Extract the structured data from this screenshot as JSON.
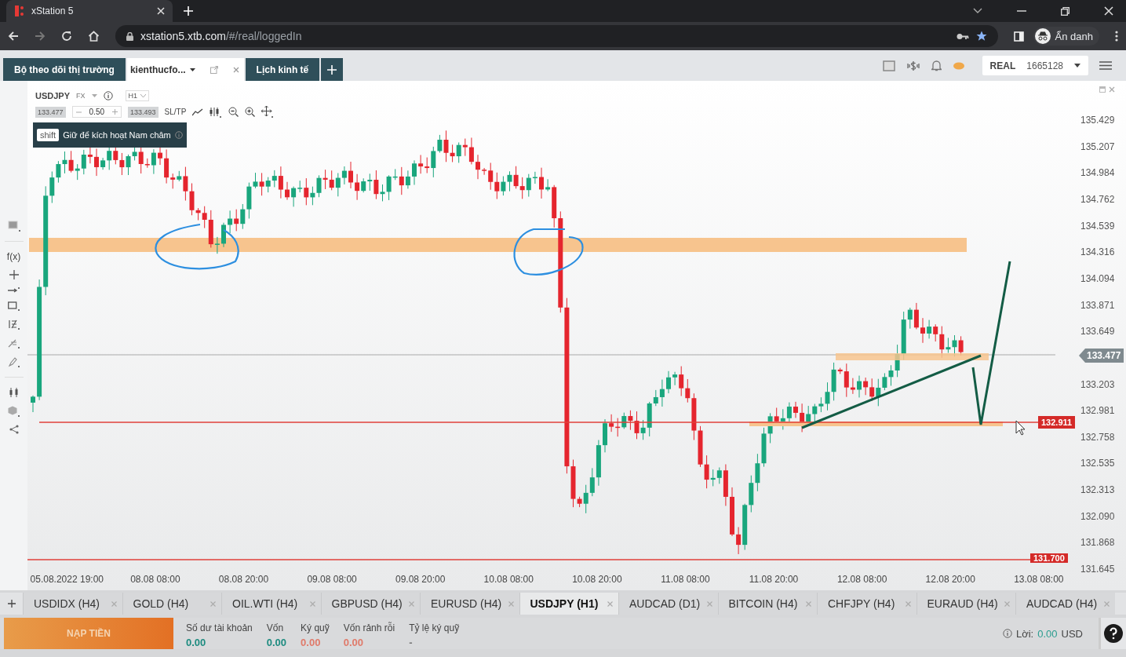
{
  "browser": {
    "tab_title": "xStation 5",
    "url_host": "xstation5.xtb.com",
    "url_path": "/#/real/loggedIn",
    "profile": "Ẩn danh"
  },
  "app_tabs": [
    {
      "label": "Bộ theo dõi thị trường",
      "selected": false
    },
    {
      "label": "kienthucfo...",
      "selected": true
    },
    {
      "label": "Lịch kinh tế",
      "selected": false
    }
  ],
  "account": {
    "mode": "REAL",
    "number": "1665128"
  },
  "chart": {
    "symbol": "USDJPY",
    "market": "FX",
    "timeframe": "H1",
    "bid": "133.477",
    "volume": "0.50",
    "ask": "133.493",
    "sltp": "SL/TP",
    "hint_key": "shift",
    "hint": "Giữ để kích hoạt Nam châm",
    "tools_label": "f(x)",
    "price_ticks": [
      "135.429",
      "135.207",
      "134.984",
      "134.762",
      "134.539",
      "134.316",
      "134.094",
      "133.871",
      "133.649",
      "133.203",
      "132.981",
      "132.758",
      "132.535",
      "132.313",
      "132.090",
      "131.868",
      "131.645"
    ],
    "time_ticks": [
      "05.08.2022 19:00",
      "08.08 08:00",
      "08.08 20:00",
      "09.08 08:00",
      "09.08 20:00",
      "10.08 08:00",
      "10.08 20:00",
      "11.08 08:00",
      "11.08 20:00",
      "12.08 08:00",
      "12.08 20:00",
      "13.08 08:00"
    ],
    "current_price": "133.477",
    "line_price": "132.911",
    "low_line_price": "131.700"
  },
  "instrument_tabs": [
    {
      "label": "USDIDX (H4)",
      "selected": false
    },
    {
      "label": "GOLD (H4)",
      "selected": false
    },
    {
      "label": "OIL.WTI (H4)",
      "selected": false
    },
    {
      "label": "GBPUSD (H4)",
      "selected": false
    },
    {
      "label": "EURUSD (H4)",
      "selected": false
    },
    {
      "label": "USDJPY (H1)",
      "selected": true
    },
    {
      "label": "AUDCAD (D1)",
      "selected": false
    },
    {
      "label": "BITCOIN (H4)",
      "selected": false
    },
    {
      "label": "CHFJPY (H4)",
      "selected": false
    },
    {
      "label": "EURAUD (H4)",
      "selected": false
    },
    {
      "label": "AUDCAD (H4)",
      "selected": false
    }
  ],
  "footer": {
    "deposit": "NẠP TIỀN",
    "stats": [
      {
        "label": "Số dư tài khoản",
        "value": "0.00",
        "color": "#1e8c80"
      },
      {
        "label": "Vốn",
        "value": "0.00",
        "color": "#1e8c80"
      },
      {
        "label": "Ký quỹ",
        "value": "0.00",
        "color": "#e07a6a"
      },
      {
        "label": "Vốn rảnh rỗi",
        "value": "0.00",
        "color": "#e07a6a"
      },
      {
        "label": "Tỷ lệ ký quỹ",
        "value": "-",
        "color": "#777777"
      }
    ],
    "profit_label": "Lời:",
    "profit_value": "0.00",
    "currency": "USD"
  }
}
